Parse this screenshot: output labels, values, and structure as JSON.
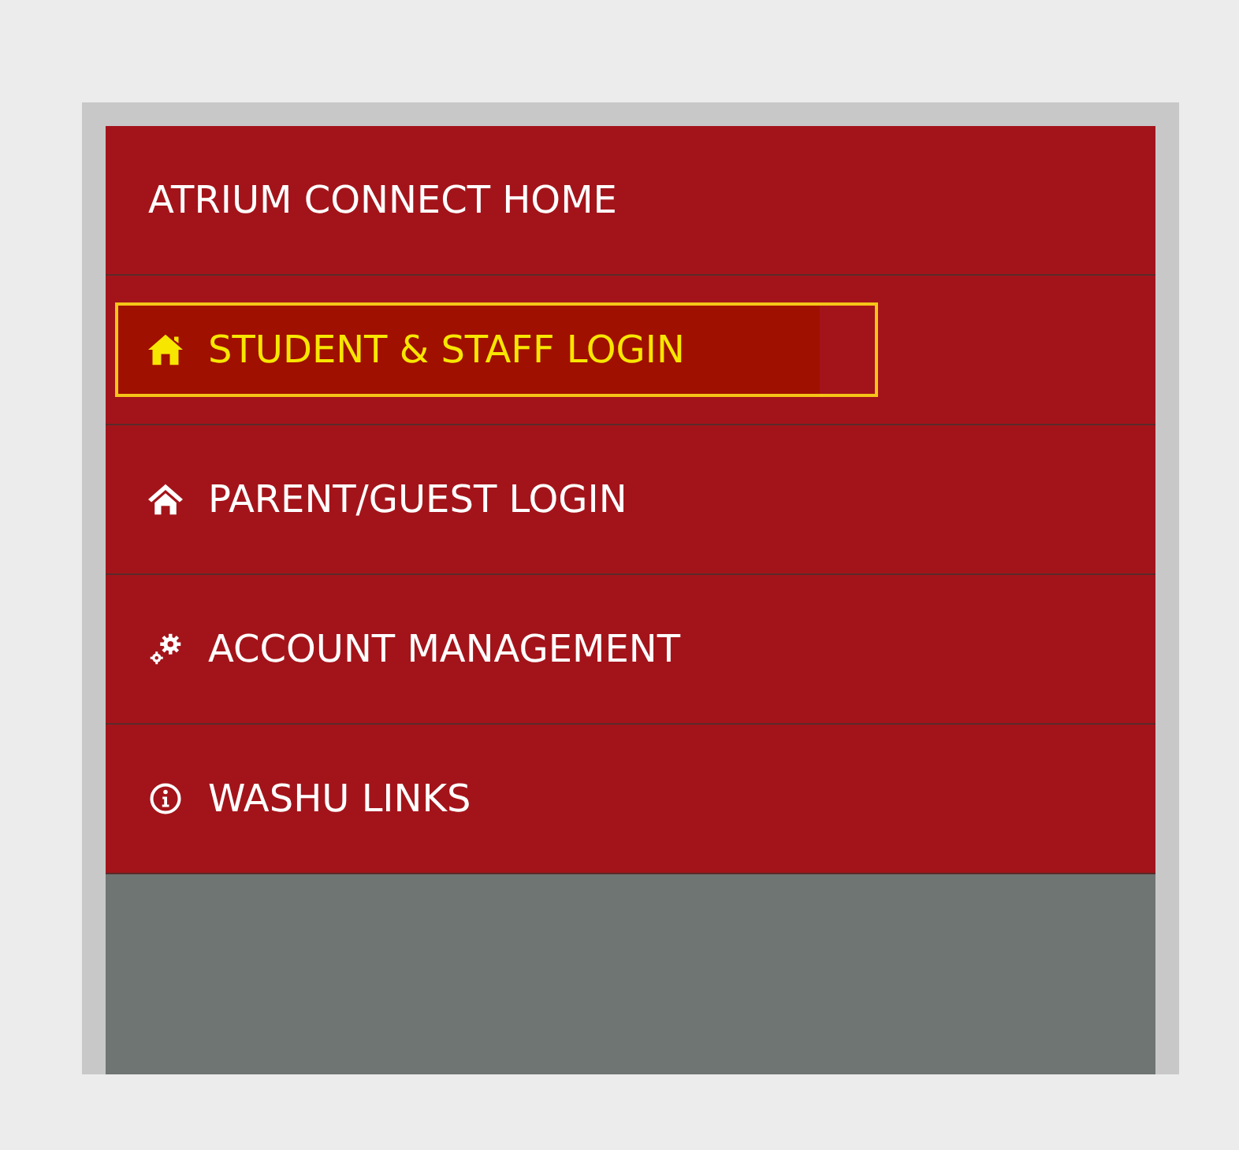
{
  "menu": {
    "items": [
      {
        "label": "ATRIUM CONNECT HOME",
        "kind": "plain",
        "selected": false
      },
      {
        "label": "STUDENT & STAFF LOGIN",
        "kind": "home",
        "selected": true
      },
      {
        "label": "PARENT/GUEST LOGIN",
        "kind": "guest",
        "selected": false
      },
      {
        "label": "ACCOUNT MANAGEMENT",
        "kind": "account",
        "selected": false
      },
      {
        "label": "WASHU LINKS",
        "kind": "links",
        "selected": false
      }
    ]
  }
}
